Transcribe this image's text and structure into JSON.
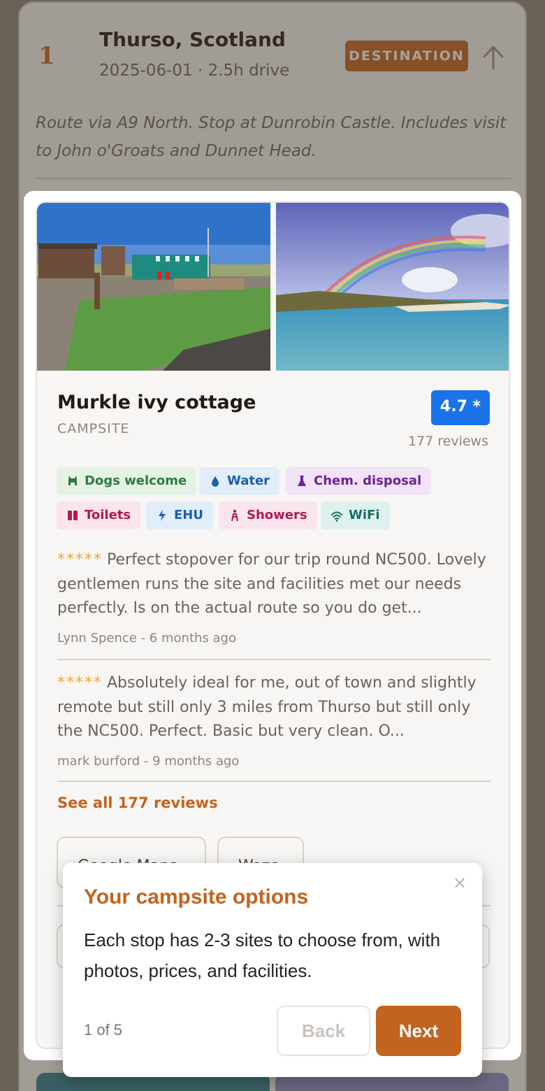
{
  "stop": {
    "number": "1",
    "title": "Thurso, Scotland",
    "meta": "2025-06-01 · 2.5h drive",
    "badge": "DESTINATION",
    "route_note": "Route via A9 North. Stop at Dunrobin Castle. Includes visit to John o'Groats and Dunnet Head."
  },
  "campsite": {
    "name": "Murkle ivy cottage",
    "type": "CAMPSITE",
    "rating": "4.7 *",
    "reviews_count": "177 reviews",
    "amenities": [
      {
        "label": "Dogs welcome",
        "icon": "dog-icon"
      },
      {
        "label": "Water",
        "icon": "water-drop-icon"
      },
      {
        "label": "Chem. disposal",
        "icon": "flask-icon"
      },
      {
        "label": "Toilets",
        "icon": "toilet-icon"
      },
      {
        "label": "EHU",
        "icon": "lightning-icon"
      },
      {
        "label": "Showers",
        "icon": "shower-icon"
      },
      {
        "label": "WiFi",
        "icon": "wifi-icon"
      }
    ],
    "reviews": [
      {
        "stars": "*****",
        "text": "Perfect stopover for our trip round NC500. Lovely gentlemen runs the site and facilities met our needs perfectly. Is on the actual route so you do get...",
        "author": "Lynn Spence - 6 months ago"
      },
      {
        "stars": "*****",
        "text": "Absolutely ideal for me, out of town and slightly remote but still only 3 miles from Thurso but still only the NC500. Perfect. Basic but very clean. O...",
        "author": "mark burford - 9 months ago"
      }
    ],
    "see_all": "See all 177 reviews",
    "nav_buttons": [
      "Google Maps",
      "Waze"
    ]
  },
  "tour": {
    "title": "Your campsite options",
    "body": "Each stop has 2-3 sites to choose from, with photos, prices, and facilities.",
    "progress": "1 of 5",
    "back_label": "Back",
    "next_label": "Next",
    "close_label": "×"
  },
  "colors": {
    "accent": "#c2631f",
    "rating_blue": "#1a73e8",
    "star_gold": "#f2a52b"
  }
}
